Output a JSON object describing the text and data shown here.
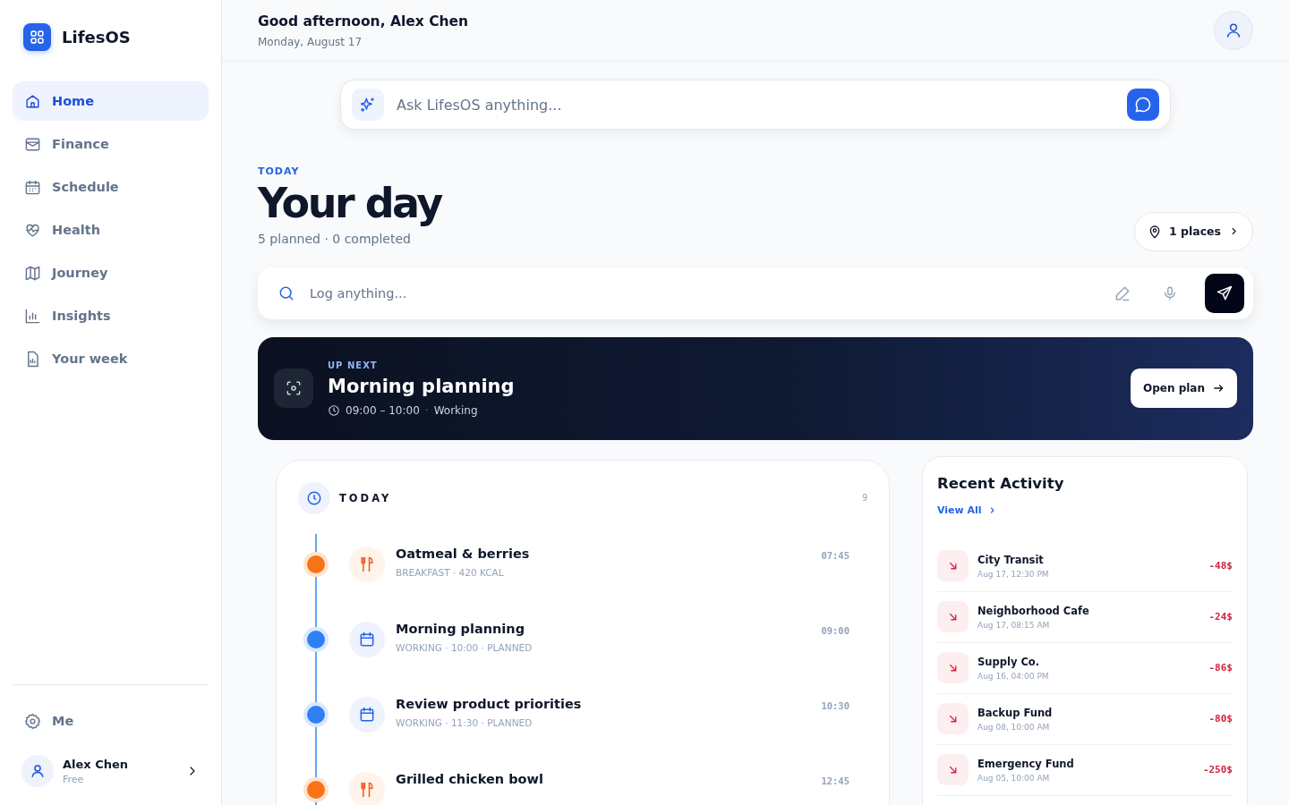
{
  "sidebar": {
    "logo": "LifesOS",
    "items": [
      {
        "label": "Home",
        "selected": true
      },
      {
        "label": "Finance",
        "selected": false
      },
      {
        "label": "Schedule",
        "selected": false
      },
      {
        "label": "Health",
        "selected": false
      },
      {
        "label": "Journey",
        "selected": false
      },
      {
        "label": "Insights",
        "selected": false
      },
      {
        "label": "Your week",
        "selected": false
      }
    ],
    "settings": "Me",
    "user": {
      "name": "Alex Chen",
      "plan": "Free"
    }
  },
  "header": {
    "greeting": "Good afternoon, Alex Chen",
    "date": "Monday, August 17"
  },
  "ask": {
    "placeholder": "Ask LifesOS anything..."
  },
  "day": {
    "eyebrow": "TODAY",
    "title": "Your day",
    "summary": "5 planned · 0 completed",
    "places": "1 places"
  },
  "log": {
    "placeholder": "Log anything..."
  },
  "up_next": {
    "eyebrow": "UP NEXT",
    "title": "Morning planning",
    "time": "09:00 – 10:00",
    "separator": "·",
    "category": "Working",
    "button": "Open plan"
  },
  "timeline": {
    "title": "TODAY",
    "count": "9",
    "items": [
      {
        "kind": "meal",
        "title": "Oatmeal & berries",
        "meta": "BREAKFAST · 420 KCAL",
        "time": "07:45"
      },
      {
        "kind": "work",
        "title": "Morning planning",
        "meta": "WORKING · 10:00 · PLANNED",
        "time": "09:00"
      },
      {
        "kind": "work",
        "title": "Review product priorities",
        "meta": "WORKING · 11:30 · PLANNED",
        "time": "10:30"
      },
      {
        "kind": "meal",
        "title": "Grilled chicken bowl",
        "time": "12:45"
      }
    ]
  },
  "activity": {
    "title": "Recent Activity",
    "link": "View All",
    "rows": [
      {
        "name": "City Transit",
        "date": "Aug 17, 12:30 PM",
        "amount": "-48$"
      },
      {
        "name": "Neighborhood Cafe",
        "date": "Aug 17, 08:15 AM",
        "amount": "-24$"
      },
      {
        "name": "Supply Co.",
        "date": "Aug 16, 04:00 PM",
        "amount": "-86$"
      },
      {
        "name": "Backup Fund",
        "date": "Aug 08, 10:00 AM",
        "amount": "-80$"
      },
      {
        "name": "Emergency Fund",
        "date": "Aug 05, 10:00 AM",
        "amount": "-250$"
      }
    ]
  }
}
